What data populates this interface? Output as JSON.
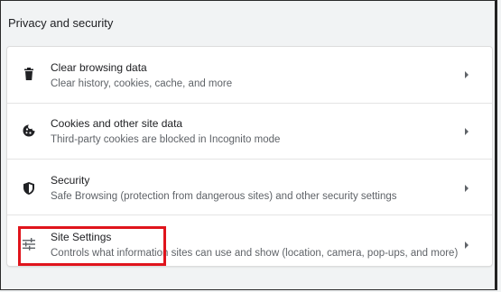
{
  "section": {
    "title": "Privacy and security"
  },
  "rows": [
    {
      "title": "Clear browsing data",
      "subtitle": "Clear history, cookies, cache, and more",
      "icon": "trash-icon"
    },
    {
      "title": "Cookies and other site data",
      "subtitle": "Third-party cookies are blocked in Incognito mode",
      "icon": "cookie-icon"
    },
    {
      "title": "Security",
      "subtitle": "Safe Browsing (protection from dangerous sites) and other security settings",
      "icon": "shield-icon"
    },
    {
      "title": "Site Settings",
      "subtitle": "Controls what information sites can use and show (location, camera, pop-ups, and more)",
      "icon": "tune-icon"
    }
  ],
  "colors": {
    "highlight": "#e0141c",
    "title": "#202124",
    "subtitle": "#5f6368",
    "icon": "#5f6368"
  }
}
